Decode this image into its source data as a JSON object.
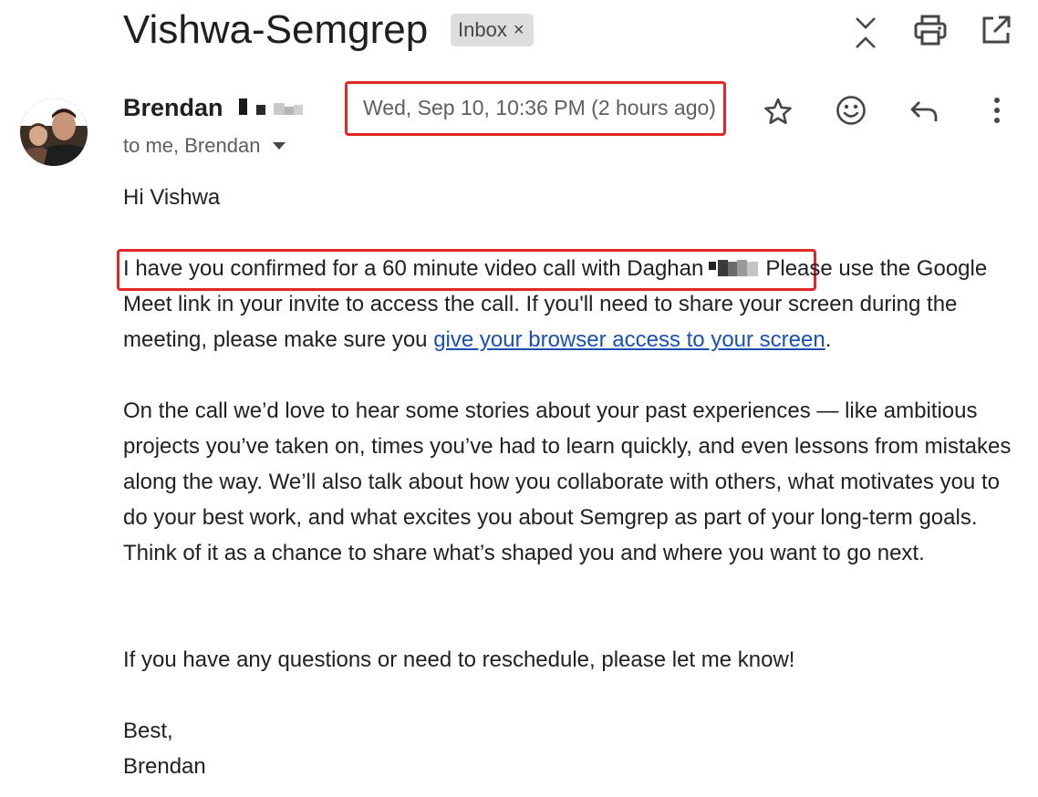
{
  "thread": {
    "subject": "Vishwa-Semgrep",
    "label_chip": "Inbox",
    "label_remove": "×"
  },
  "toolbar_icons": [
    "collapse-expand-icon",
    "print-icon",
    "open-in-new-window-icon"
  ],
  "message": {
    "sender_name": "Brendan",
    "recipients": "to me, Brendan",
    "date": "Wed, Sep 10, 10:36 PM (2 hours ago)",
    "header_icons": [
      "star-icon",
      "emoji-reaction-icon",
      "reply-icon",
      "more-options-icon"
    ]
  },
  "body": {
    "greeting": "Hi Vishwa",
    "p1_part1": "I have you confirmed for a 60 minute video call with Daghan",
    "p1_part2": "Please use the Google Meet link in your invite to access the call. If you'll need to share your screen during the meeting, please make sure you",
    "p1_link": "give your browser access to your screen",
    "p1_end": ".",
    "p2": "On the call we’d love to hear some stories about your past experiences — like ambitious projects you’ve taken on, times you’ve had to learn quickly, and even lessons from mistakes along the way. We’ll also talk about how you collaborate with others, what motivates you to do your best work, and what excites you about Semgrep as part of your long-term goals. Think of it as a chance to share what’s shaped you and where you want to go next.",
    "p3": "If you have any questions or need to reschedule, please let me know!",
    "signoff": "Best,",
    "signature": "Brendan"
  },
  "colors": {
    "highlight_border": "#e32626",
    "link": "#1a4fb8",
    "chip_bg": "#dddddd"
  }
}
